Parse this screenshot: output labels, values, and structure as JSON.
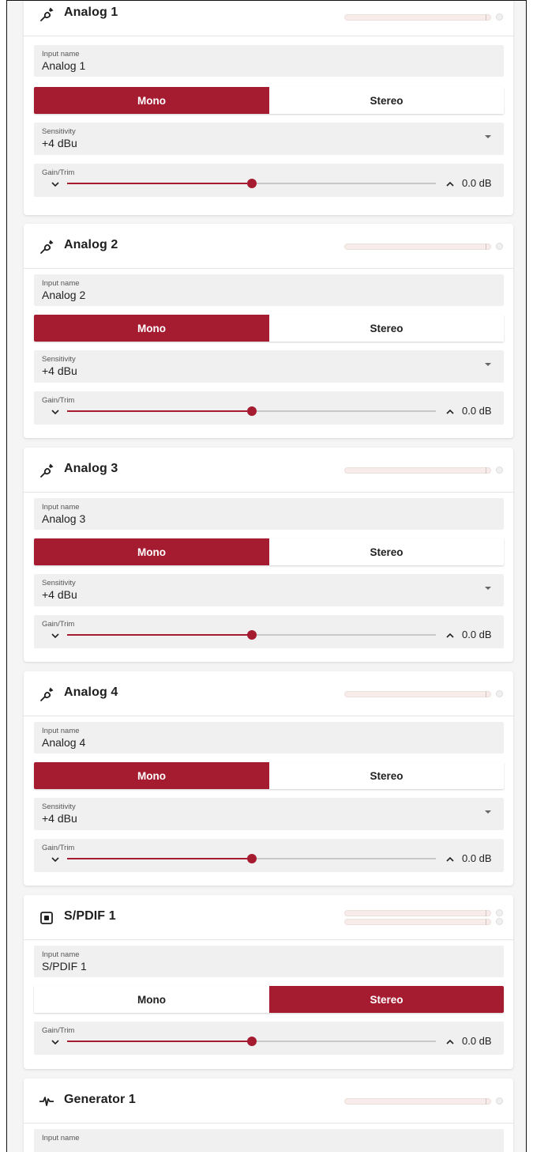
{
  "labels": {
    "input_name": "Input name",
    "sensitivity": "Sensitivity",
    "gain_trim": "Gain/Trim",
    "mono": "Mono",
    "stereo": "Stereo"
  },
  "accent_color": "#a51c30",
  "channels": [
    {
      "title": "Analog 1",
      "icon": "microphone-icon",
      "input_name": "Analog 1",
      "mode": "Mono",
      "sensitivity": "+4 dBu",
      "gain_value": "0.0 dB",
      "gain_fraction": 0.5,
      "meters": 1
    },
    {
      "title": "Analog 2",
      "icon": "microphone-icon",
      "input_name": "Analog 2",
      "mode": "Mono",
      "sensitivity": "+4 dBu",
      "gain_value": "0.0 dB",
      "gain_fraction": 0.5,
      "meters": 1
    },
    {
      "title": "Analog 3",
      "icon": "microphone-icon",
      "input_name": "Analog 3",
      "mode": "Mono",
      "sensitivity": "+4 dBu",
      "gain_value": "0.0 dB",
      "gain_fraction": 0.5,
      "meters": 1
    },
    {
      "title": "Analog 4",
      "icon": "microphone-icon",
      "input_name": "Analog 4",
      "mode": "Mono",
      "sensitivity": "+4 dBu",
      "gain_value": "0.0 dB",
      "gain_fraction": 0.5,
      "meters": 1
    },
    {
      "title": "S/PDIF 1",
      "icon": "spdif-port-icon",
      "input_name": "S/PDIF 1",
      "mode": "Stereo",
      "gain_value": "0.0 dB",
      "gain_fraction": 0.5,
      "meters": 2
    },
    {
      "title": "Generator 1",
      "icon": "waveform-icon",
      "meters": 1
    }
  ]
}
